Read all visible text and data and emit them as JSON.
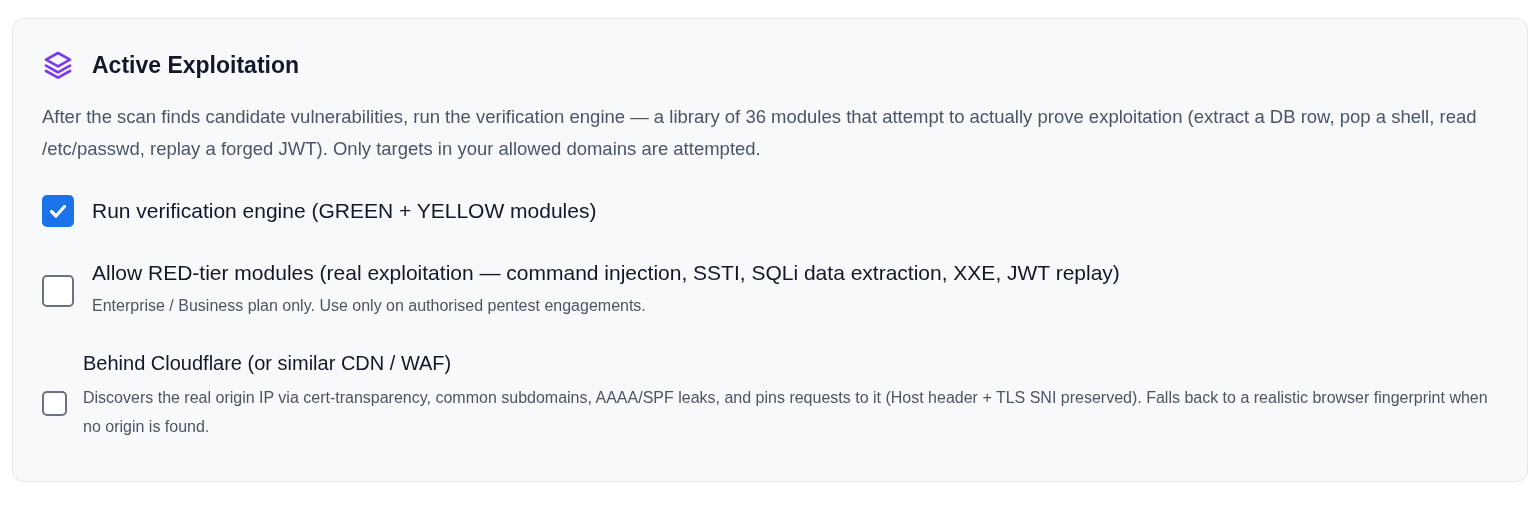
{
  "section": {
    "title": "Active Exploitation",
    "description": "After the scan finds candidate vulnerabilities, run the verification engine — a library of 36 modules that attempt to actually prove exploitation (extract a DB row, pop a shell, read /etc/passwd, replay a forged JWT). Only targets in your allowed domains are attempted.",
    "options": [
      {
        "kind": "large",
        "label": "Run verification engine (GREEN + YELLOW modules)",
        "checked": true
      },
      {
        "kind": "large",
        "label": "Allow RED-tier modules (real exploitation — command injection, SSTI, SQLi data extraction, XXE, JWT replay)",
        "hint": "Enterprise / Business plan only. Use only on authorised pentest engagements.",
        "checked": false
      },
      {
        "kind": "compact",
        "label": "Behind Cloudflare (or similar CDN / WAF)",
        "hint": "Discovers the real origin IP via cert-transparency, common subdomains, AAAA/SPF leaks, and pins requests to it (Host header + TLS SNI preserved). Falls back to a realistic browser fingerprint when no origin is found.",
        "checked": false
      }
    ]
  }
}
